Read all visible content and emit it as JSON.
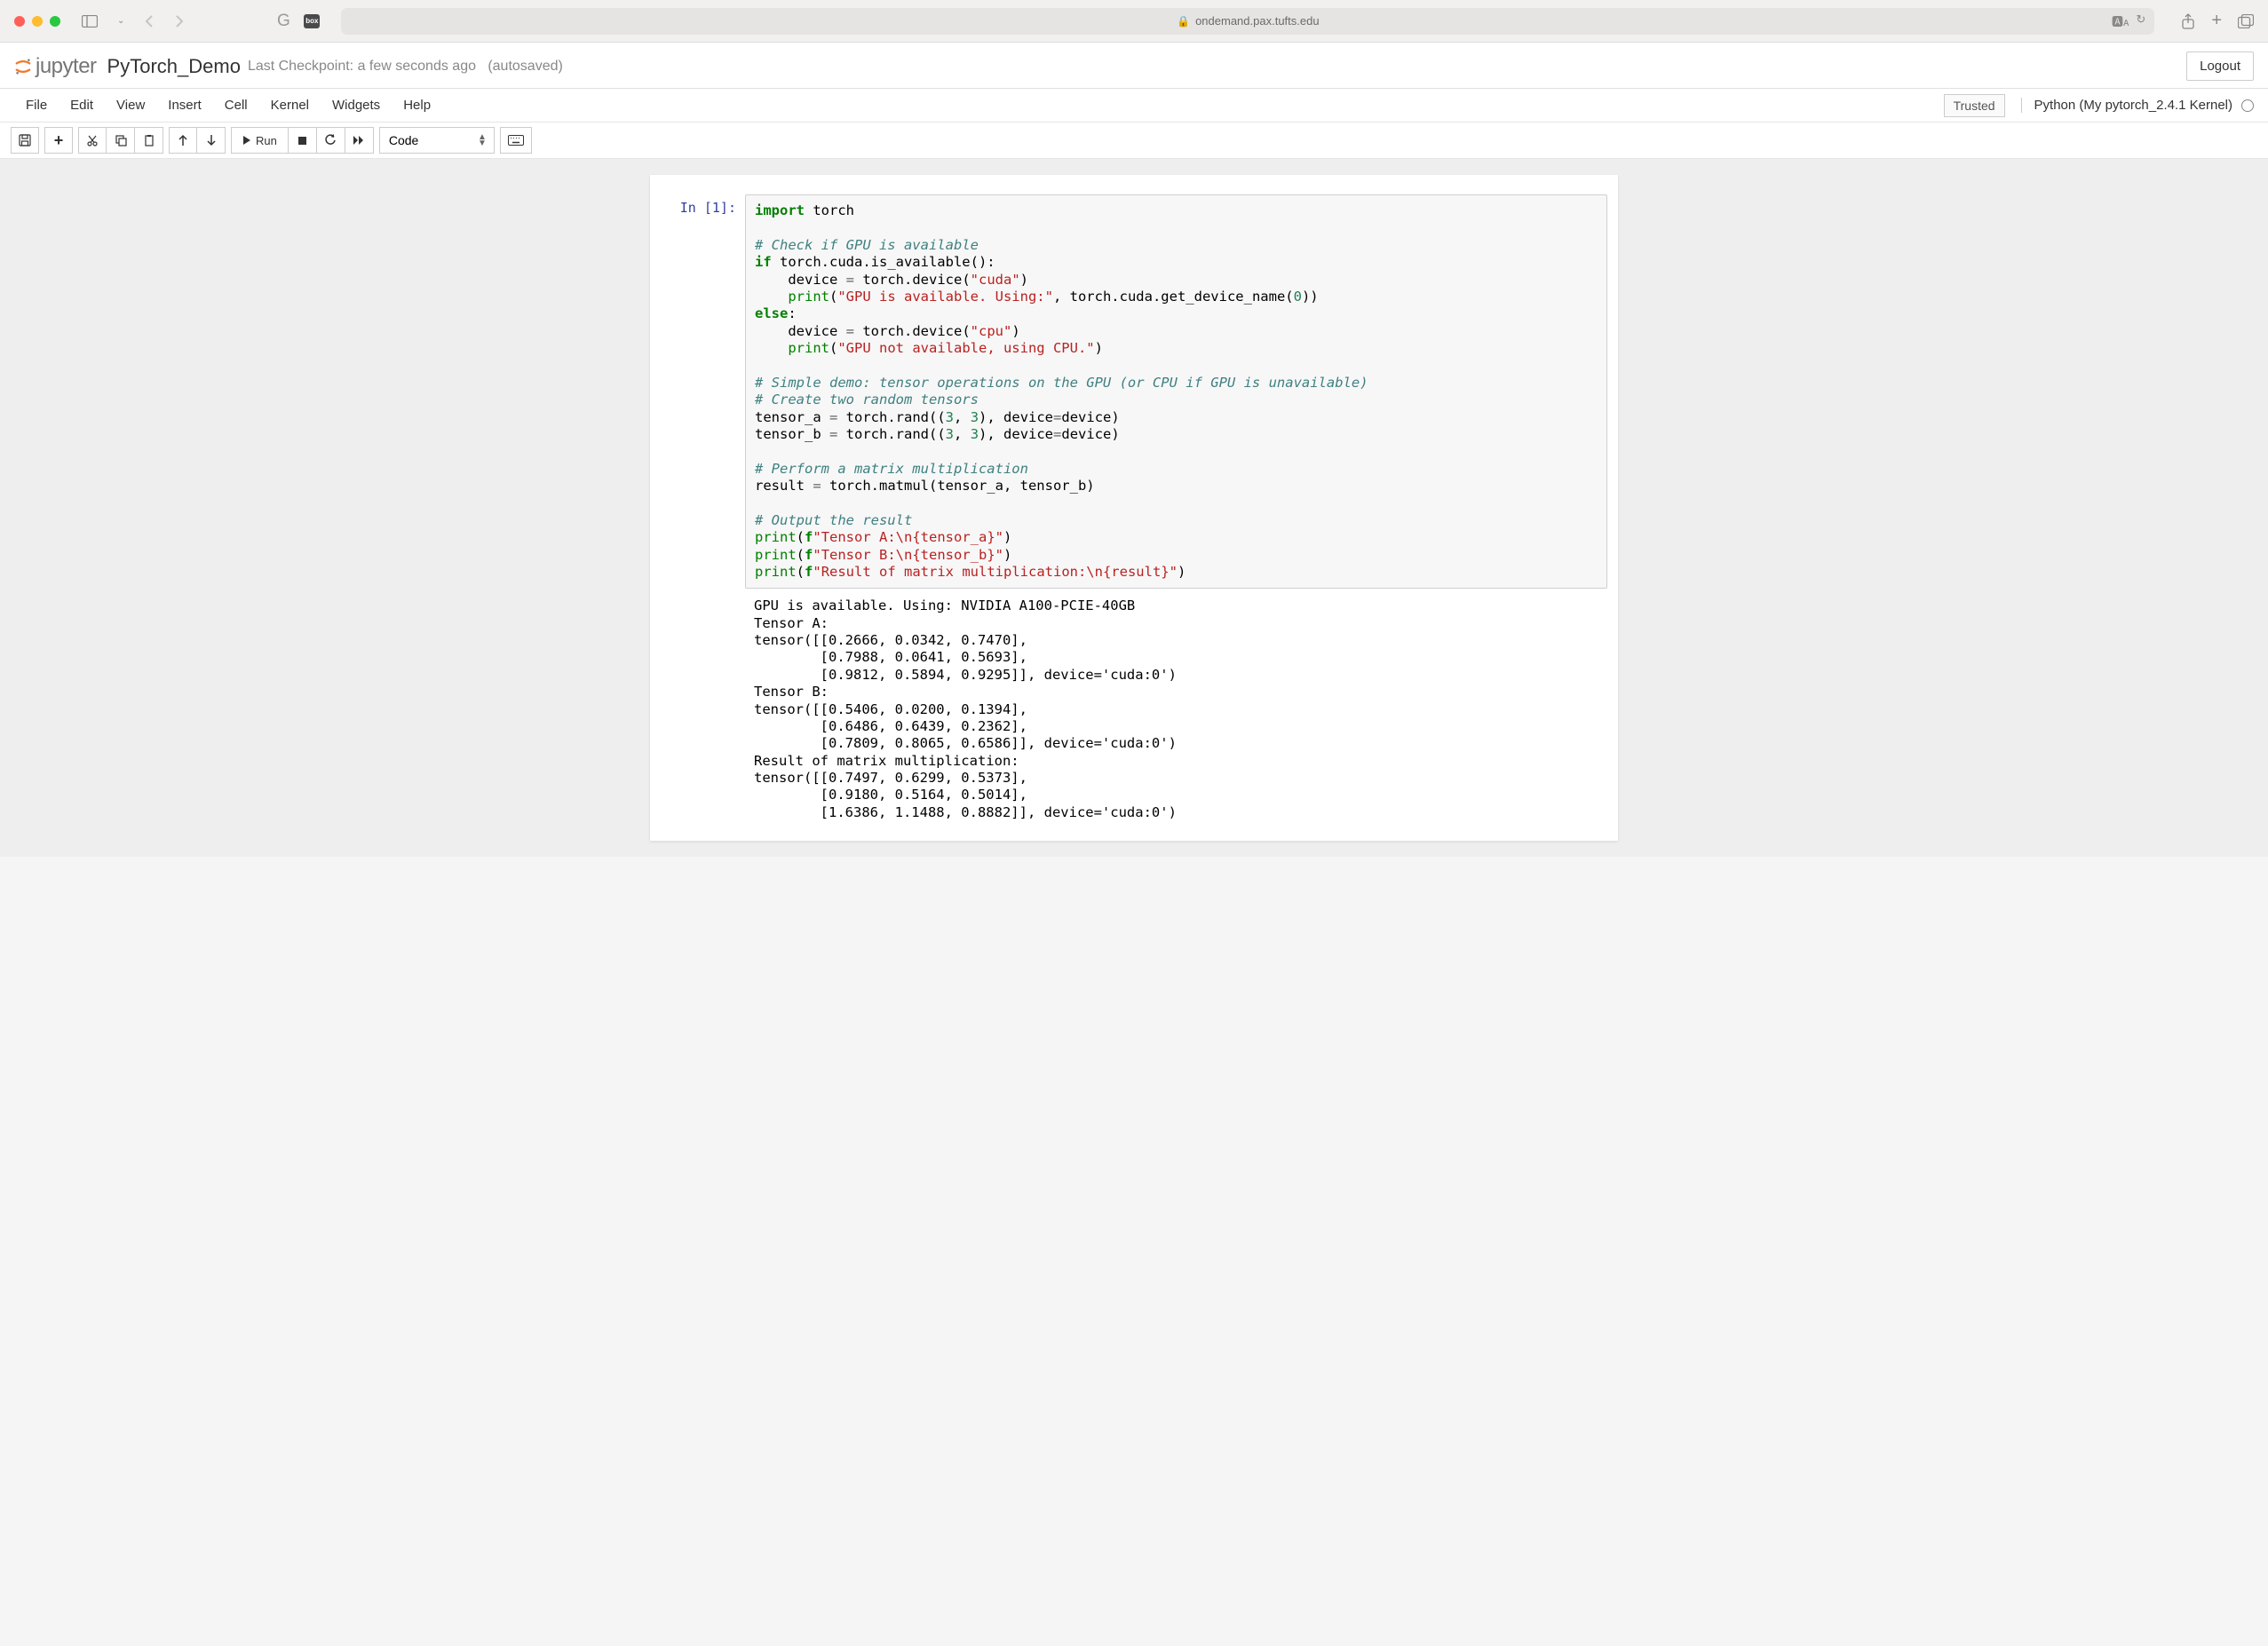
{
  "browser": {
    "url_host": "ondemand.pax.tufts.edu"
  },
  "header": {
    "logo_text": "jupyter",
    "notebook_name": "PyTorch_Demo",
    "checkpoint_prefix": "Last Checkpoint: ",
    "checkpoint_time": "a few seconds ago",
    "autosaved": "(autosaved)",
    "logout": "Logout"
  },
  "menubar": {
    "items": [
      "File",
      "Edit",
      "View",
      "Insert",
      "Cell",
      "Kernel",
      "Widgets",
      "Help"
    ],
    "trusted": "Trusted",
    "kernel_name": "Python (My pytorch_2.4.1 Kernel)"
  },
  "toolbar": {
    "run_label": "Run",
    "cell_type": "Code"
  },
  "cell": {
    "prompt": "In [1]:",
    "code_tokens": [
      {
        "t": "kw",
        "v": "import"
      },
      {
        "t": "",
        "v": " torch\n\n"
      },
      {
        "t": "comment",
        "v": "# Check if GPU is available"
      },
      {
        "t": "",
        "v": "\n"
      },
      {
        "t": "kw",
        "v": "if"
      },
      {
        "t": "",
        "v": " torch.cuda.is_available():\n    device "
      },
      {
        "t": "op",
        "v": "="
      },
      {
        "t": "",
        "v": " torch.device("
      },
      {
        "t": "str",
        "v": "\"cuda\""
      },
      {
        "t": "",
        "v": ")\n    "
      },
      {
        "t": "builtin",
        "v": "print"
      },
      {
        "t": "",
        "v": "("
      },
      {
        "t": "str",
        "v": "\"GPU is available. Using:\""
      },
      {
        "t": "",
        "v": ", torch.cuda.get_device_name("
      },
      {
        "t": "num",
        "v": "0"
      },
      {
        "t": "",
        "v": "))\n"
      },
      {
        "t": "kw",
        "v": "else"
      },
      {
        "t": "",
        "v": ":\n    device "
      },
      {
        "t": "op",
        "v": "="
      },
      {
        "t": "",
        "v": " torch.device("
      },
      {
        "t": "str",
        "v": "\"cpu\""
      },
      {
        "t": "",
        "v": ")\n    "
      },
      {
        "t": "builtin",
        "v": "print"
      },
      {
        "t": "",
        "v": "("
      },
      {
        "t": "str",
        "v": "\"GPU not available, using CPU.\""
      },
      {
        "t": "",
        "v": ")\n\n"
      },
      {
        "t": "comment",
        "v": "# Simple demo: tensor operations on the GPU (or CPU if GPU is unavailable)"
      },
      {
        "t": "",
        "v": "\n"
      },
      {
        "t": "comment",
        "v": "# Create two random tensors"
      },
      {
        "t": "",
        "v": "\ntensor_a "
      },
      {
        "t": "op",
        "v": "="
      },
      {
        "t": "",
        "v": " torch.rand(("
      },
      {
        "t": "num",
        "v": "3"
      },
      {
        "t": "",
        "v": ", "
      },
      {
        "t": "num",
        "v": "3"
      },
      {
        "t": "",
        "v": "), device"
      },
      {
        "t": "op",
        "v": "="
      },
      {
        "t": "",
        "v": "device)\ntensor_b "
      },
      {
        "t": "op",
        "v": "="
      },
      {
        "t": "",
        "v": " torch.rand(("
      },
      {
        "t": "num",
        "v": "3"
      },
      {
        "t": "",
        "v": ", "
      },
      {
        "t": "num",
        "v": "3"
      },
      {
        "t": "",
        "v": "), device"
      },
      {
        "t": "op",
        "v": "="
      },
      {
        "t": "",
        "v": "device)\n\n"
      },
      {
        "t": "comment",
        "v": "# Perform a matrix multiplication"
      },
      {
        "t": "",
        "v": "\nresult "
      },
      {
        "t": "op",
        "v": "="
      },
      {
        "t": "",
        "v": " torch.matmul(tensor_a, tensor_b)\n\n"
      },
      {
        "t": "comment",
        "v": "# Output the result"
      },
      {
        "t": "",
        "v": "\n"
      },
      {
        "t": "builtin",
        "v": "print"
      },
      {
        "t": "",
        "v": "("
      },
      {
        "t": "kw",
        "v": "f"
      },
      {
        "t": "str",
        "v": "\"Tensor A:\\n{tensor_a}\""
      },
      {
        "t": "",
        "v": ")\n"
      },
      {
        "t": "builtin",
        "v": "print"
      },
      {
        "t": "",
        "v": "("
      },
      {
        "t": "kw",
        "v": "f"
      },
      {
        "t": "str",
        "v": "\"Tensor B:\\n{tensor_b}\""
      },
      {
        "t": "",
        "v": ")\n"
      },
      {
        "t": "builtin",
        "v": "print"
      },
      {
        "t": "",
        "v": "("
      },
      {
        "t": "kw",
        "v": "f"
      },
      {
        "t": "str",
        "v": "\"Result of matrix multiplication:\\n{result}\""
      },
      {
        "t": "",
        "v": ")"
      }
    ],
    "output": "GPU is available. Using: NVIDIA A100-PCIE-40GB\nTensor A:\ntensor([[0.2666, 0.0342, 0.7470],\n        [0.7988, 0.0641, 0.5693],\n        [0.9812, 0.5894, 0.9295]], device='cuda:0')\nTensor B:\ntensor([[0.5406, 0.0200, 0.1394],\n        [0.6486, 0.6439, 0.2362],\n        [0.7809, 0.8065, 0.6586]], device='cuda:0')\nResult of matrix multiplication:\ntensor([[0.7497, 0.6299, 0.5373],\n        [0.9180, 0.5164, 0.5014],\n        [1.6386, 1.1488, 0.8882]], device='cuda:0')"
  }
}
